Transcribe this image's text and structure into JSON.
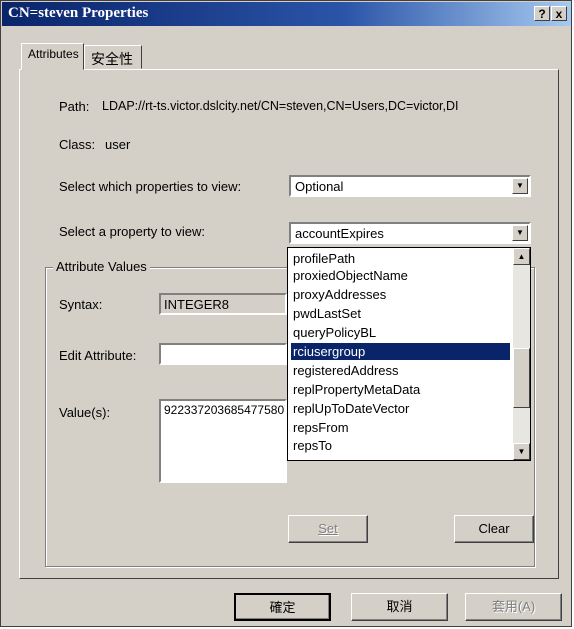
{
  "window": {
    "title": "CN=steven Properties",
    "help_btn": "?",
    "close_btn": "x"
  },
  "tabs": [
    {
      "label": "Attributes"
    },
    {
      "label": "安全性"
    }
  ],
  "path": {
    "label": "Path:",
    "value": "LDAP://rt-ts.victor.dslcity.net/CN=steven,CN=Users,DC=victor,DI"
  },
  "class": {
    "label": "Class:",
    "value": "user"
  },
  "properties_filter": {
    "label": "Select which properties to view:",
    "selected": "Optional"
  },
  "property_select": {
    "label": "Select a property to view:",
    "selected": "accountExpires",
    "options": [
      "profilePath",
      "proxiedObjectName",
      "proxyAddresses",
      "pwdLastSet",
      "queryPolicyBL",
      "rciusergroup",
      "registeredAddress",
      "replPropertyMetaData",
      "replUpToDateVector",
      "repsFrom",
      "repsTo"
    ],
    "highlighted": "rciusergroup"
  },
  "attribute_values": {
    "legend": "Attribute Values",
    "syntax_label": "Syntax:",
    "syntax_value": "INTEGER8",
    "edit_label": "Edit Attribute:",
    "edit_value": "",
    "values_label": "Value(s):",
    "values_value": "9223372036854775807"
  },
  "buttons": {
    "set": "Set",
    "clear": "Clear",
    "ok": "確定",
    "cancel": "取消",
    "apply": "套用(A)"
  }
}
